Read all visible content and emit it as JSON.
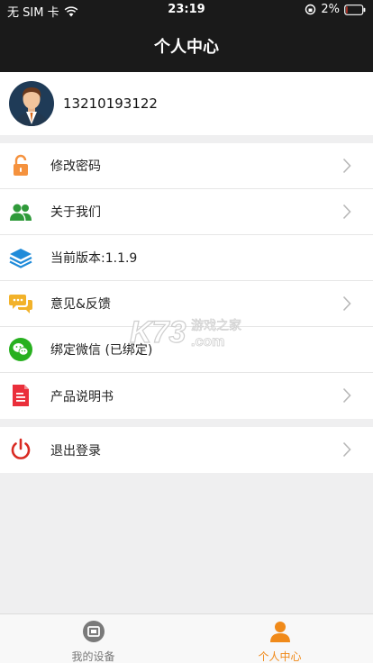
{
  "status_bar": {
    "carrier": "无 SIM 卡",
    "time": "23:19",
    "battery": "2%"
  },
  "header": {
    "title": "个人中心"
  },
  "profile": {
    "phone": "13210193122"
  },
  "menu": [
    {
      "label": "修改密码",
      "icon": "unlock-icon",
      "color": "#f5923e"
    },
    {
      "label": "关于我们",
      "icon": "users-icon",
      "color": "#2f9a3a"
    },
    {
      "label": "当前版本:1.1.9",
      "icon": "layers-icon",
      "color": "#1f8bd9"
    },
    {
      "label": "意见&反馈",
      "icon": "chat-icon",
      "color": "#f2b22a"
    },
    {
      "label": "绑定微信 (已绑定)",
      "icon": "wechat-icon",
      "color": "#27b01f"
    },
    {
      "label": "产品说明书",
      "icon": "document-icon",
      "color": "#ea2f3b"
    }
  ],
  "logout": {
    "label": "退出登录",
    "icon": "power-icon",
    "color": "#d92b23"
  },
  "watermark": {
    "brand": "K73",
    "text1": "游戏之家",
    "text2": ".com"
  },
  "tabbar": {
    "tabs": [
      {
        "label": "我的设备",
        "icon": "device-icon",
        "active": false
      },
      {
        "label": "个人中心",
        "icon": "person-icon",
        "active": true
      }
    ],
    "active_color": "#f08a1a",
    "inactive_color": "#777777"
  }
}
